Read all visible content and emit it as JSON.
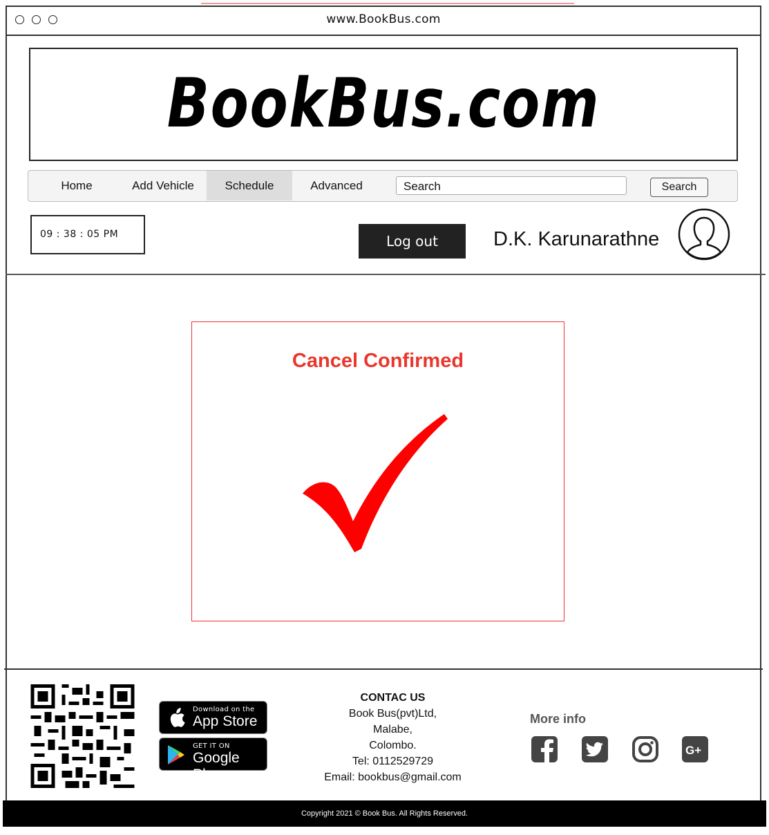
{
  "browser": {
    "url": "www.BookBus.com"
  },
  "header": {
    "logo": "BookBus.com"
  },
  "nav": {
    "items": [
      {
        "label": "Home"
      },
      {
        "label": "Add Vehicle"
      },
      {
        "label": "Schedule",
        "active": true
      },
      {
        "label": "Advanced"
      }
    ],
    "search_value": "Search",
    "search_button": "Search"
  },
  "userbar": {
    "clock": "09 : 38 : 05 PM",
    "logout_label": "Log out",
    "user_name": "D.K. Karunarathne"
  },
  "modal": {
    "title": "Cancel Confirmed",
    "check_color": "#ff0000",
    "title_color": "#e8372c"
  },
  "footer": {
    "app_store": {
      "small": "Download on the",
      "big": "App Store"
    },
    "google_play": {
      "small": "GET IT ON",
      "big": "Google Play"
    },
    "contact": {
      "heading": "CONTAC US",
      "lines": [
        "Book Bus(pvt)Ltd,",
        "Malabe,",
        "Colombo.",
        "Tel: 0112529729",
        "Email: bookbus@gmail.com"
      ]
    },
    "more_info": "More info",
    "social_icons": [
      "facebook-icon",
      "twitter-icon",
      "instagram-icon",
      "google-plus-icon"
    ],
    "copyright": "Copyright 2021 © Book Bus. All Rights Reserved."
  }
}
